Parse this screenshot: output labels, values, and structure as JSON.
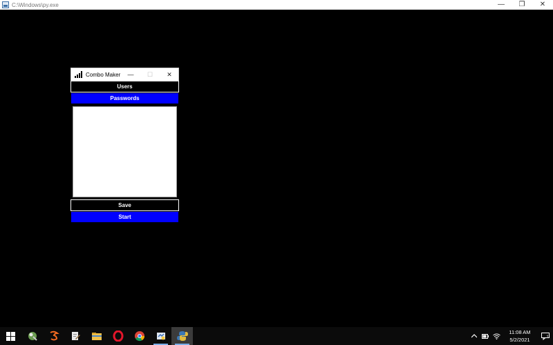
{
  "console": {
    "title": "C:\\Windows\\py.exe",
    "minimize": "—",
    "restore": "❐",
    "close": "✕"
  },
  "app": {
    "title": "Combo Maker",
    "minimize": "—",
    "maximize": "☐",
    "close": "✕",
    "users_button": "Users",
    "passwords_button": "Passwords",
    "textbox_value": "",
    "save_button": "Save",
    "start_button": "Start",
    "colors": {
      "black_button": "#000000",
      "blue_button": "#0000ff",
      "text": "#ffffff"
    }
  },
  "taskbar": {
    "items": [
      {
        "icon": "windows-start-icon"
      },
      {
        "icon": "solitaire-icon"
      },
      {
        "icon": "firefox-icon"
      },
      {
        "icon": "text-editor-icon"
      },
      {
        "icon": "file-explorer-icon"
      },
      {
        "icon": "opera-icon"
      },
      {
        "icon": "chrome-icon"
      },
      {
        "icon": "python-idle-icon"
      },
      {
        "icon": "python-icon"
      }
    ],
    "tray": {
      "time": "11:08 AM",
      "date": "5/2/2021",
      "notification_count": "1"
    }
  }
}
